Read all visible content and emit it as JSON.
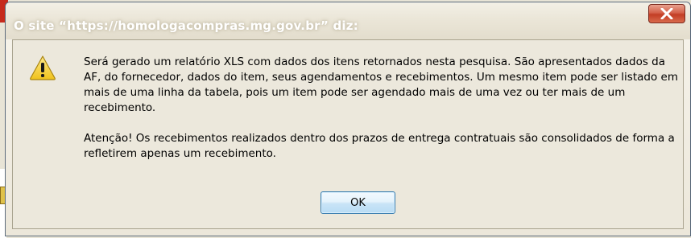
{
  "dialog": {
    "title": "O site “https://homologacompras.mg.gov.br” diz:",
    "message_paragraphs": [
      "Será gerado um relatório XLS com dados dos itens retornados nesta pesquisa. São apresentados dados da AF, do fornecedor, dados do item, seus agendamentos e recebimentos. Um mesmo item pode ser listado em mais de uma linha da tabela, pois um item pode ser agendado mais de uma vez ou ter mais de um recebimento.",
      "Atenção! Os recebimentos realizados dentro dos prazos de entrega contratuais são consolidados de forma a refletirem apenas um recebimento."
    ],
    "ok_label": "OK",
    "icon": "warning-icon",
    "close_icon": "close-icon"
  },
  "colors": {
    "close_button": "#c23d24",
    "ok_border": "#3c7fb1",
    "warning_fill": "#f5d03a"
  }
}
